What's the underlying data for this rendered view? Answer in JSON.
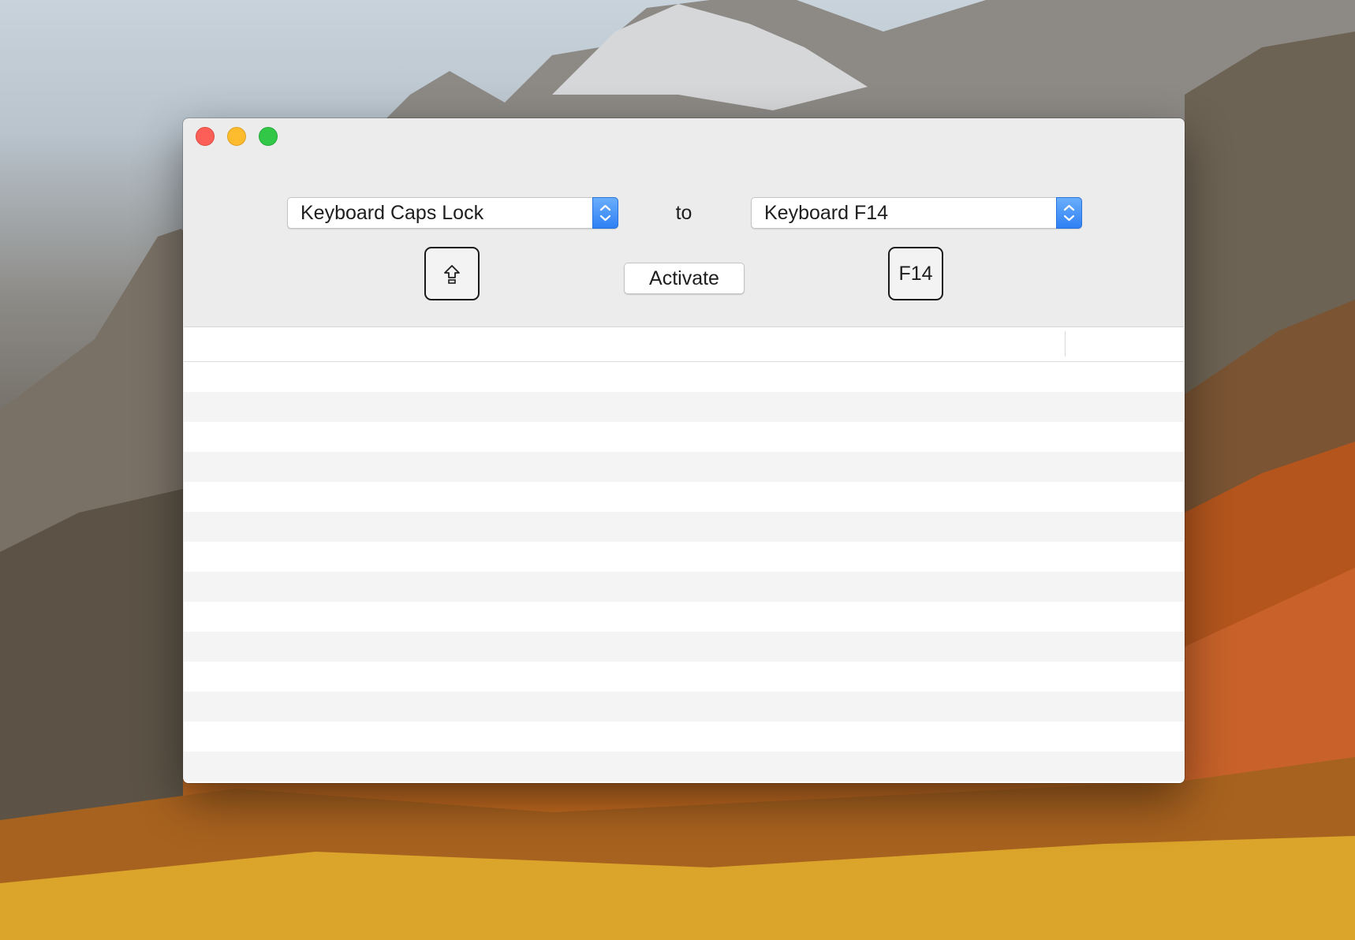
{
  "window": {
    "controls": [
      "close",
      "minimize",
      "zoom"
    ]
  },
  "mapping": {
    "source_key": "Keyboard Caps Lock",
    "connector": "to",
    "target_key": "Keyboard F14",
    "source_keycap_icon": "caps-lock-icon",
    "target_keycap_label": "F14",
    "activate_label": "Activate"
  },
  "table": {
    "columns": [
      "",
      ""
    ],
    "rows": []
  }
}
